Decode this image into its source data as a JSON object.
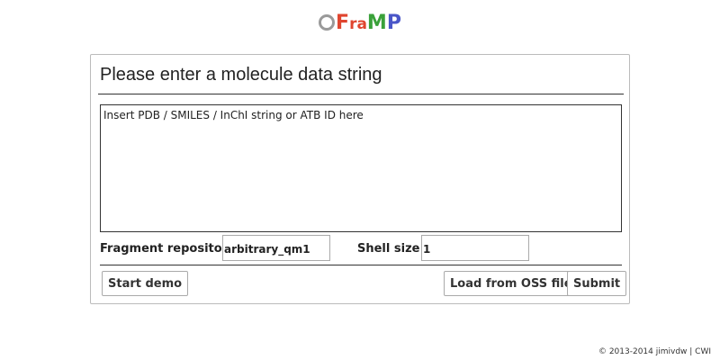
{
  "logo": {
    "letters": [
      {
        "char": "F",
        "color": "#e0452f"
      },
      {
        "char": "ra",
        "color": "#e0452f"
      },
      {
        "char": "M",
        "color": "#3aa13a"
      },
      {
        "char": "P",
        "color": "#4a56c8"
      }
    ],
    "ring_color": "#9a9a9a"
  },
  "panel": {
    "title": "Please enter a molecule data string",
    "input": {
      "placeholder": "Insert PDB / SMILES / InChI string or ATB ID here",
      "value": ""
    },
    "fragment_repository": {
      "label": "Fragment repository",
      "value": "arbitrary_qm1"
    },
    "shell_size": {
      "label": "Shell size",
      "value": "1"
    },
    "buttons": {
      "start_demo": "Start demo",
      "load_oss": "Load from OSS file",
      "submit": "Submit"
    }
  },
  "footer": {
    "text": "© 2013-2014 jimivdw | CWI"
  }
}
